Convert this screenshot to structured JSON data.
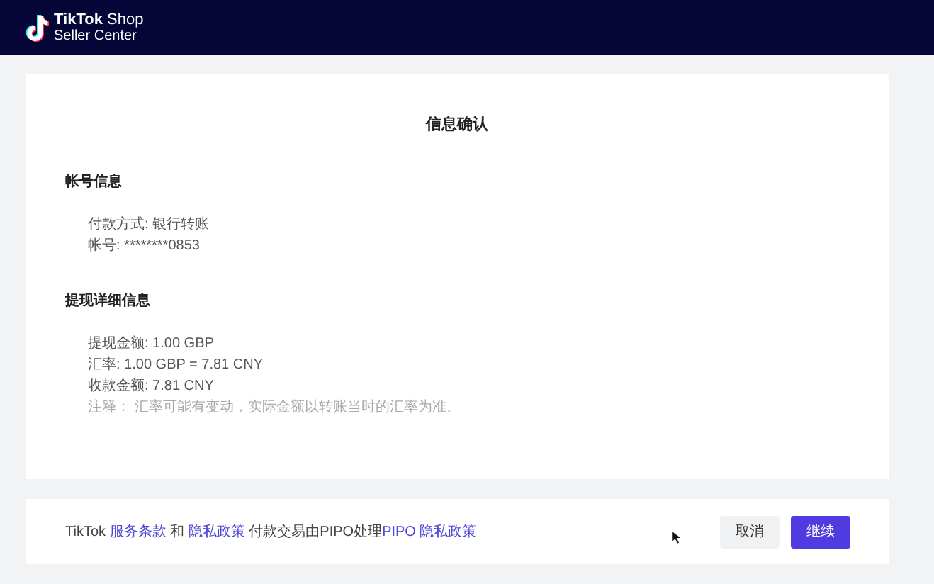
{
  "header": {
    "logo_line_1": [
      "TikTok",
      "Shop"
    ],
    "logo_line_2": "Seller Center"
  },
  "dialog": {
    "title": "信息确认",
    "sections": [
      {
        "heading": "帐号信息",
        "lines": [
          {
            "text": "付款方式: 银行转账",
            "kind": "value"
          },
          {
            "text": "帐号: ********0853",
            "kind": "value"
          }
        ]
      },
      {
        "heading": "提现详细信息",
        "lines": [
          {
            "text": "提现金额: 1.00 GBP",
            "kind": "value"
          },
          {
            "text": "汇率: 1.00 GBP = 7.81 CNY",
            "kind": "value"
          },
          {
            "text": "收款金额: 7.81 CNY",
            "kind": "value"
          },
          {
            "text": "注释：  汇率可能有变动，实际金额以转账当时的汇率为准。",
            "kind": "note"
          }
        ]
      }
    ]
  },
  "footer": {
    "terms": [
      {
        "text": "TikTok ",
        "kind": "text"
      },
      {
        "text": "服务条款",
        "kind": "link"
      },
      {
        "text": " 和 ",
        "kind": "text"
      },
      {
        "text": "隐私政策",
        "kind": "link"
      },
      {
        "text": " 付款交易由PIPO处理",
        "kind": "text"
      },
      {
        "text": "PIPO 隐私政策",
        "kind": "link"
      }
    ],
    "buttons": [
      {
        "label": "取消",
        "kind": "secondary"
      },
      {
        "label": "继续",
        "kind": "primary"
      }
    ]
  }
}
